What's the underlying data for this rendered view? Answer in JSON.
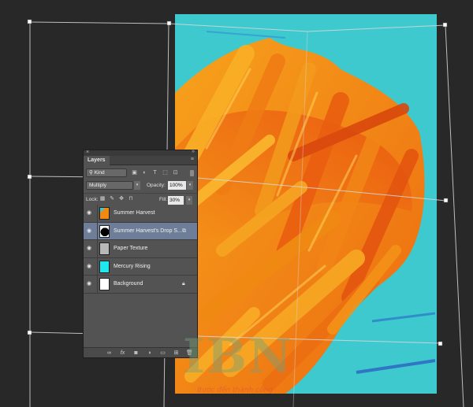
{
  "layers_panel": {
    "title": "Layers",
    "filter": {
      "kind_label": "Kind"
    },
    "blend_mode": "Multiply",
    "opacity_label": "Opacity:",
    "opacity_value": "100%",
    "lock_label": "Lock:",
    "fill_label": "Fill:",
    "fill_value": "30%",
    "layers": [
      {
        "name": "Summer Harvest",
        "visible": true,
        "selected": false,
        "thumb": "orange-paint",
        "badge": ""
      },
      {
        "name": "Summer Harvest's Drop S...",
        "visible": true,
        "selected": true,
        "thumb": "black-mask",
        "badge": "smart-object-icon"
      },
      {
        "name": "Paper Texture",
        "visible": true,
        "selected": false,
        "thumb": "gray",
        "badge": ""
      },
      {
        "name": "Mercury Rising",
        "visible": true,
        "selected": false,
        "thumb": "cyan",
        "badge": ""
      },
      {
        "name": "Background",
        "visible": true,
        "selected": false,
        "thumb": "white",
        "badge": "lock-icon"
      }
    ]
  },
  "watermark": {
    "logo": "IBN",
    "slogan": "Bước đến thành công"
  },
  "colors": {
    "workspace": "#282828",
    "canvas_bg": "#3ec9cf",
    "paint_orange": "#f08a12",
    "paint_deep": "#e2500f",
    "panel_bg": "#535353",
    "selected_row": "#6e7e98"
  }
}
